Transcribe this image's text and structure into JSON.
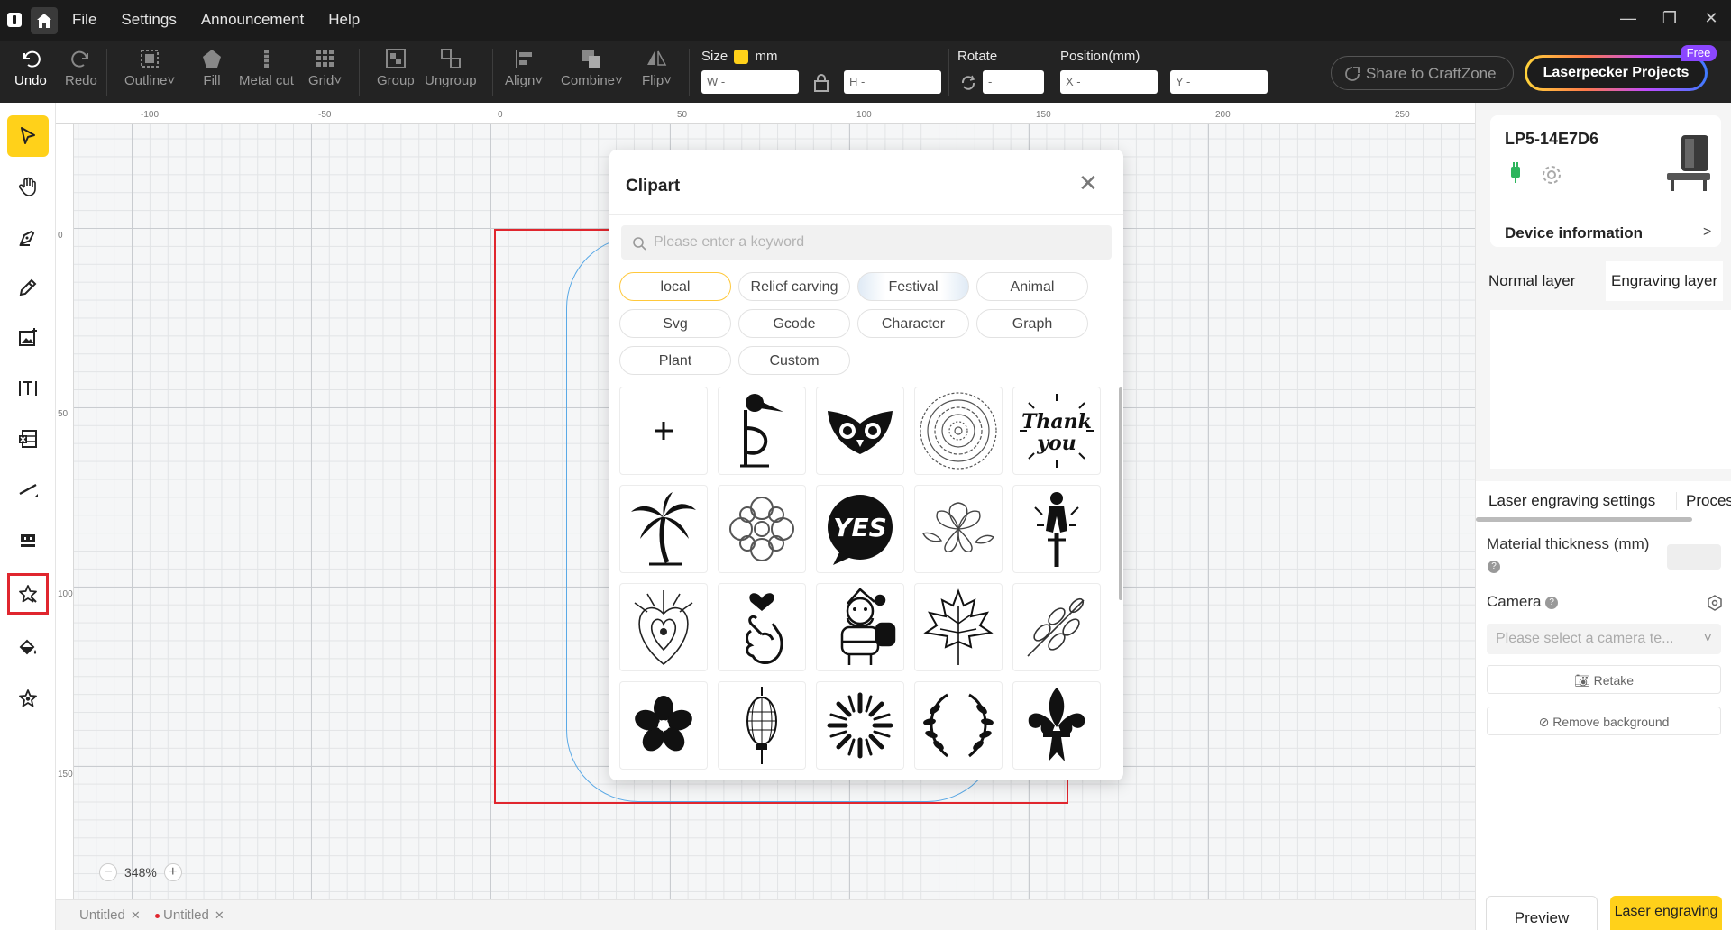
{
  "menu": [
    "File",
    "Settings",
    "Announcement",
    "Help"
  ],
  "toolbar": {
    "undo": "Undo",
    "redo": "Redo",
    "outline": "Outline",
    "fill": "Fill",
    "metal_cut": "Metal cut",
    "grid": "Grid",
    "group": "Group",
    "ungroup": "Ungroup",
    "align": "Align",
    "combine": "Combine",
    "flip": "Flip",
    "size_label": "Size",
    "size_unit": "mm",
    "w_placeholder": "W -",
    "h_placeholder": "H -",
    "rotate_label": "Rotate",
    "rotate_placeholder": "-",
    "position_label": "Position(mm)",
    "x_placeholder": "X -",
    "y_placeholder": "Y -",
    "share": "Share to CraftZone",
    "projects": "Laserpecker Projects",
    "free": "Free"
  },
  "ruler": {
    "top": [
      "-100",
      "-50",
      "0",
      "50",
      "100",
      "150",
      "200",
      "250"
    ],
    "left": [
      "0",
      "50",
      "100",
      "150"
    ]
  },
  "zoom": "348%",
  "doc_tabs": [
    {
      "title": "Untitled",
      "modified": false
    },
    {
      "title": "Untitled",
      "modified": true
    }
  ],
  "clipart": {
    "title": "Clipart",
    "search_placeholder": "Please enter a keyword",
    "categories": [
      "local",
      "Relief carving",
      "Festival",
      "Animal",
      "Svg",
      "Gcode",
      "Character",
      "Graph",
      "Plant",
      "Custom"
    ],
    "active_category": "local",
    "items": [
      "add",
      "bird",
      "owl",
      "mandala",
      "thank-you",
      "palm-tree",
      "ornament",
      "yes-bubble",
      "flower",
      "cyclist",
      "paisley",
      "heart-hand",
      "santa",
      "maple-leaf",
      "leaf-branch",
      "blossom",
      "lantern",
      "burst",
      "laurel-wreath",
      "fleur-de-lis"
    ],
    "thank_you_text": [
      "Thank",
      "you"
    ],
    "yes_text": "YES"
  },
  "device": {
    "name": "LP5-14E7D6",
    "info_label": "Device information"
  },
  "layers": {
    "normal": "Normal layer",
    "engraving": "Engraving layer"
  },
  "settings": {
    "tab1": "Laser engraving settings",
    "tab2": "Proces",
    "thickness_label": "Material thickness (mm)",
    "camera_label": "Camera",
    "camera_placeholder": "Please select a camera te...",
    "retake": "Retake",
    "remove_bg": "Remove background"
  },
  "footer": {
    "preview": "Preview",
    "laser": "Laser engraving"
  },
  "colors": {
    "accent": "#ffd11a",
    "selection_red": "#e0262e",
    "shape_blue": "#5aa9e6"
  }
}
